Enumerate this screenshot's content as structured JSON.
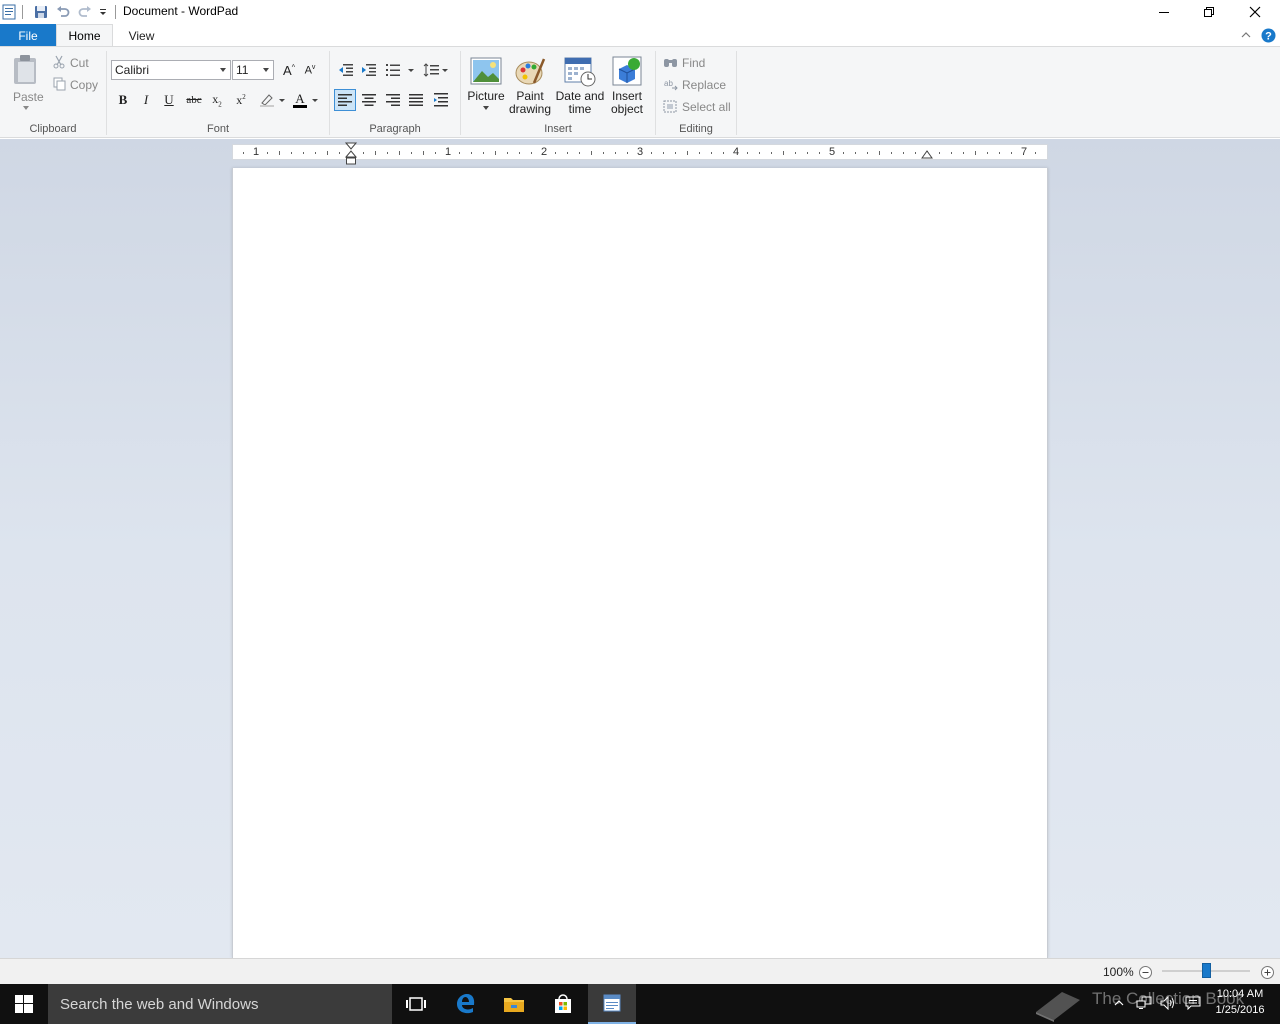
{
  "window": {
    "title": "Document - WordPad"
  },
  "tabs": {
    "file": "File",
    "home": "Home",
    "view": "View"
  },
  "ribbon": {
    "clipboard": {
      "label": "Clipboard",
      "paste": "Paste",
      "cut": "Cut",
      "copy": "Copy"
    },
    "font": {
      "label": "Font",
      "family": "Calibri",
      "size": "11"
    },
    "paragraph": {
      "label": "Paragraph"
    },
    "insert": {
      "label": "Insert",
      "picture": "Picture",
      "paint_line1": "Paint",
      "paint_line2": "drawing",
      "date_line1": "Date and",
      "date_line2": "time",
      "object_line1": "Insert",
      "object_line2": "object"
    },
    "editing": {
      "label": "Editing",
      "find": "Find",
      "replace": "Replace",
      "select_all": "Select all"
    }
  },
  "ruler": {
    "numbers": [
      "1",
      "1",
      "2",
      "3",
      "4",
      "5",
      "7"
    ]
  },
  "status": {
    "zoom": "100%",
    "zoom_level_percent": 100
  },
  "taskbar": {
    "search_placeholder": "Search the web and Windows",
    "time": "10:04 AM",
    "date": "1/25/2016",
    "watermark": "The Collection Book"
  },
  "colors": {
    "file_tab": "#1979ca",
    "ribbon_bg": "#f5f6f7",
    "taskbar_bg": "#101010",
    "search_bg": "#3b3b3b",
    "zoom_thumb": "#1979ca"
  }
}
